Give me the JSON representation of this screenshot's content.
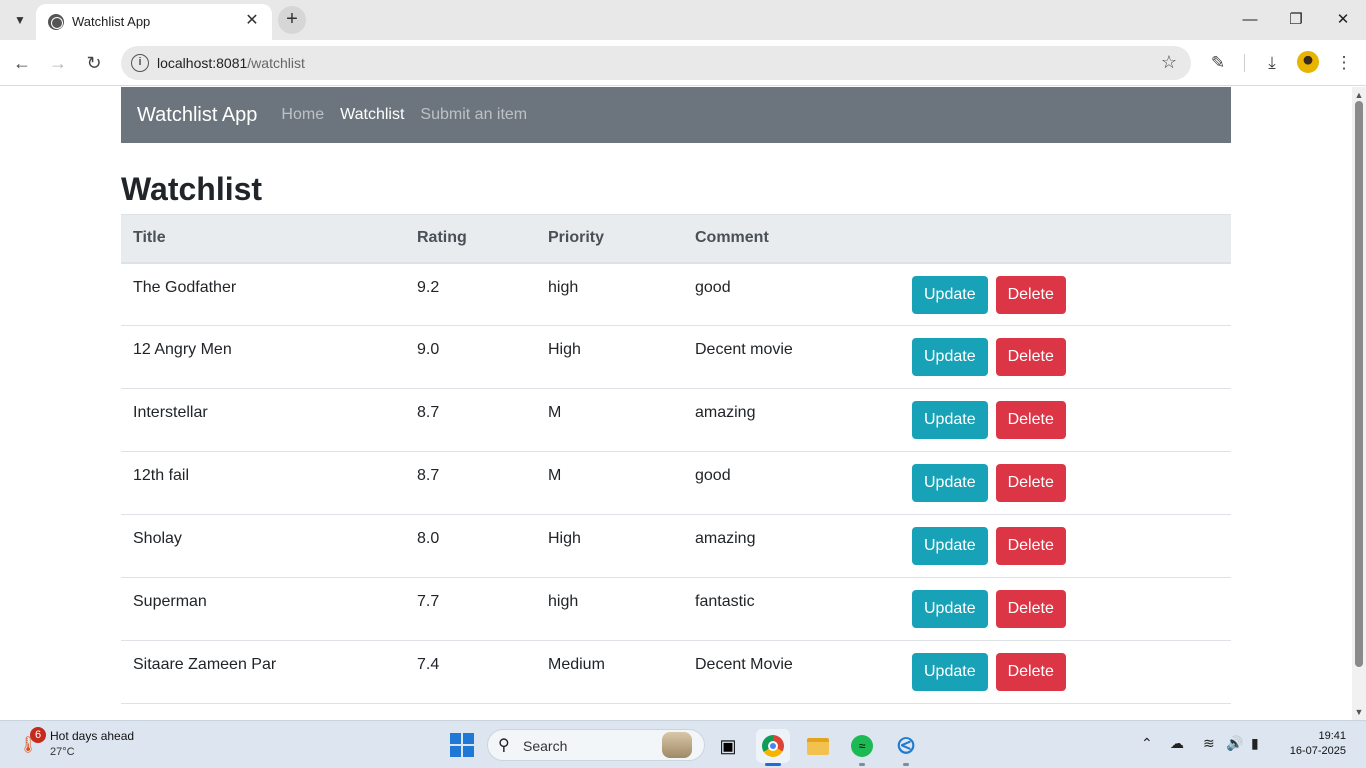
{
  "browser": {
    "tab_title": "Watchlist App",
    "url_host": "localhost:8081",
    "url_path": "/watchlist"
  },
  "navbar": {
    "brand": "Watchlist App",
    "links": [
      {
        "label": "Home",
        "active": false
      },
      {
        "label": "Watchlist",
        "active": true
      },
      {
        "label": "Submit an item",
        "active": false
      }
    ]
  },
  "page": {
    "title": "Watchlist"
  },
  "table": {
    "headers": [
      "Title",
      "Rating",
      "Priority",
      "Comment"
    ],
    "rows": [
      {
        "title": "The Godfather",
        "rating": "9.2",
        "priority": "high",
        "comment": "good"
      },
      {
        "title": "12 Angry Men",
        "rating": "9.0",
        "priority": "High",
        "comment": "Decent movie"
      },
      {
        "title": "Interstellar",
        "rating": "8.7",
        "priority": "M",
        "comment": "amazing"
      },
      {
        "title": "12th fail",
        "rating": "8.7",
        "priority": "M",
        "comment": "good"
      },
      {
        "title": "Sholay",
        "rating": "8.0",
        "priority": "High",
        "comment": "amazing"
      },
      {
        "title": "Superman",
        "rating": "7.7",
        "priority": "high",
        "comment": "fantastic"
      },
      {
        "title": "Sitaare Zameen Par",
        "rating": "7.4",
        "priority": "Medium",
        "comment": "Decent Movie"
      }
    ],
    "update_label": "Update",
    "delete_label": "Delete"
  },
  "taskbar": {
    "weather_badge": "6",
    "weather_title": "Hot days ahead",
    "weather_temp": "27°C",
    "search_label": "Search",
    "time": "19:41",
    "date": "16-07-2025"
  },
  "colors": {
    "navbar_bg": "#6c757d",
    "update_btn": "#17a2b8",
    "delete_btn": "#dc3545",
    "table_header_bg": "#e9ecef"
  }
}
